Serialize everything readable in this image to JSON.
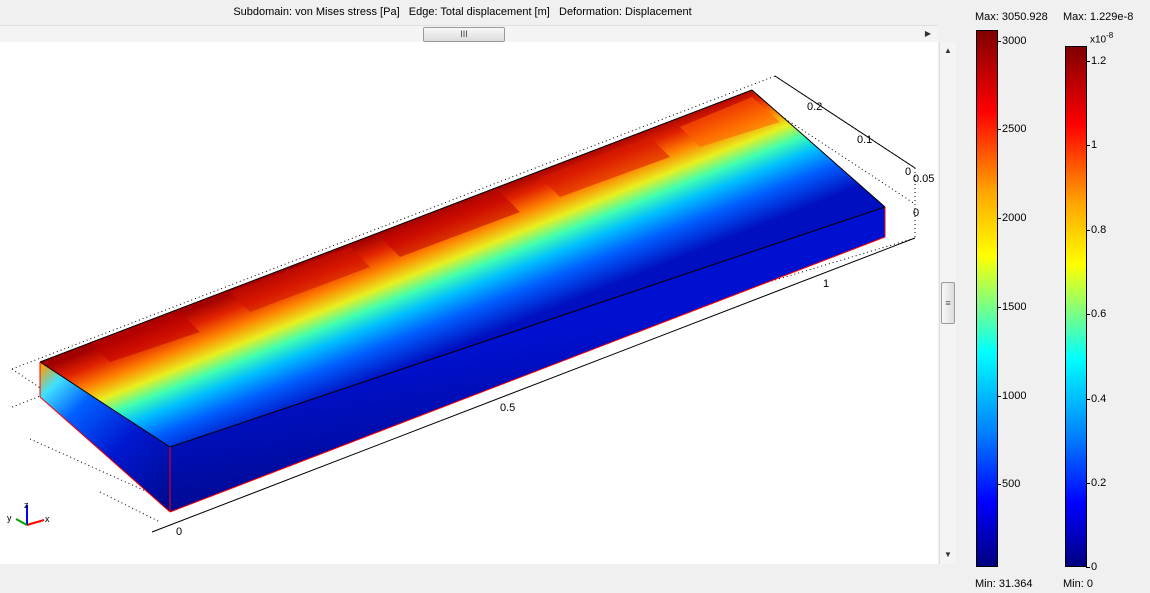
{
  "header": {
    "title": "Subdomain: von Mises stress [Pa]   Edge: Total displacement [m]   Deformation: Displacement"
  },
  "scrollbars": {
    "h_thumb_glyph": "III",
    "v_thumb_glyph": "≡",
    "right_arrow": "▶",
    "up_arrow": "▲",
    "down_arrow": "▼"
  },
  "plot": {
    "axis_labels": {
      "x0": "0",
      "x05": "0.5",
      "x1": "1",
      "y02": "0.2",
      "y01": "0.1",
      "y0": "0",
      "z005": "0.05",
      "z0": "0"
    },
    "triad": {
      "x": "x",
      "y": "y",
      "z": "z"
    }
  },
  "colorbar_stress": {
    "max_label": "Max: 3050.928",
    "min_label": "Min: 31.364",
    "ticks": [
      "3000",
      "2500",
      "2000",
      "1500",
      "1000",
      "500"
    ]
  },
  "colorbar_displacement": {
    "max_label": "Max: 1.229e-8",
    "min_label": "Min: 0",
    "exponent_label": "x10",
    "exponent_power": "-8",
    "ticks": [
      "1.2",
      "1",
      "0.8",
      "0.6",
      "0.4",
      "0.2",
      "0"
    ]
  },
  "colors": {
    "high": "#800000",
    "mid": "#ffff00",
    "low": "#000080",
    "edge": "#ff0000"
  }
}
